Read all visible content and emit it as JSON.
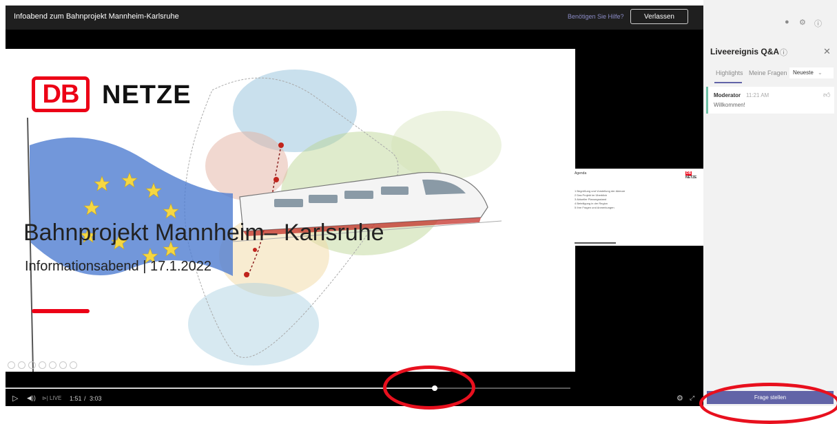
{
  "header": {
    "event_title": "Infoabend zum Bahnprojekt Mannheim-Karlsruhe",
    "help_link": "Benötigen Sie Hilfe?",
    "leave_button": "Verlassen"
  },
  "slide": {
    "logo_text": "DB",
    "brand_text": "NETZE",
    "title": "Bahnprojekt Mannheim– Karlsruhe",
    "subtitle": "Informationsabend | 17.1.2022"
  },
  "thumbnail": {
    "heading": "Agenda",
    "logo": "NETZE",
    "items": [
      "1  Begrüßung und Vorstellung der Akteure",
      "2  Das Projekt im Überblick",
      "3  Aktueller Planungsstand",
      "4  Beteiligung in der Region",
      "5  Ihre Fragen und Anmerkungen"
    ]
  },
  "player": {
    "live_label": "LIVE",
    "time_current": "1:51",
    "time_separator": "/",
    "time_total": "3:03",
    "progress": 0.76
  },
  "qa": {
    "title": "Liveereignis Q&A",
    "tabs": [
      "Highlights",
      "Meine Fragen"
    ],
    "sort_value": "Neueste",
    "messages": [
      {
        "author": "Moderator",
        "time": "11:21 AM",
        "text": "Willkommen!"
      }
    ],
    "ask_button": "Frage stellen"
  },
  "icons": {
    "top": [
      "chat-icon",
      "settings-icon",
      "info-icon"
    ]
  },
  "colors": {
    "db_red": "#ec0016",
    "teams_purple": "#6264a7",
    "annotation_red": "#e8101e"
  }
}
